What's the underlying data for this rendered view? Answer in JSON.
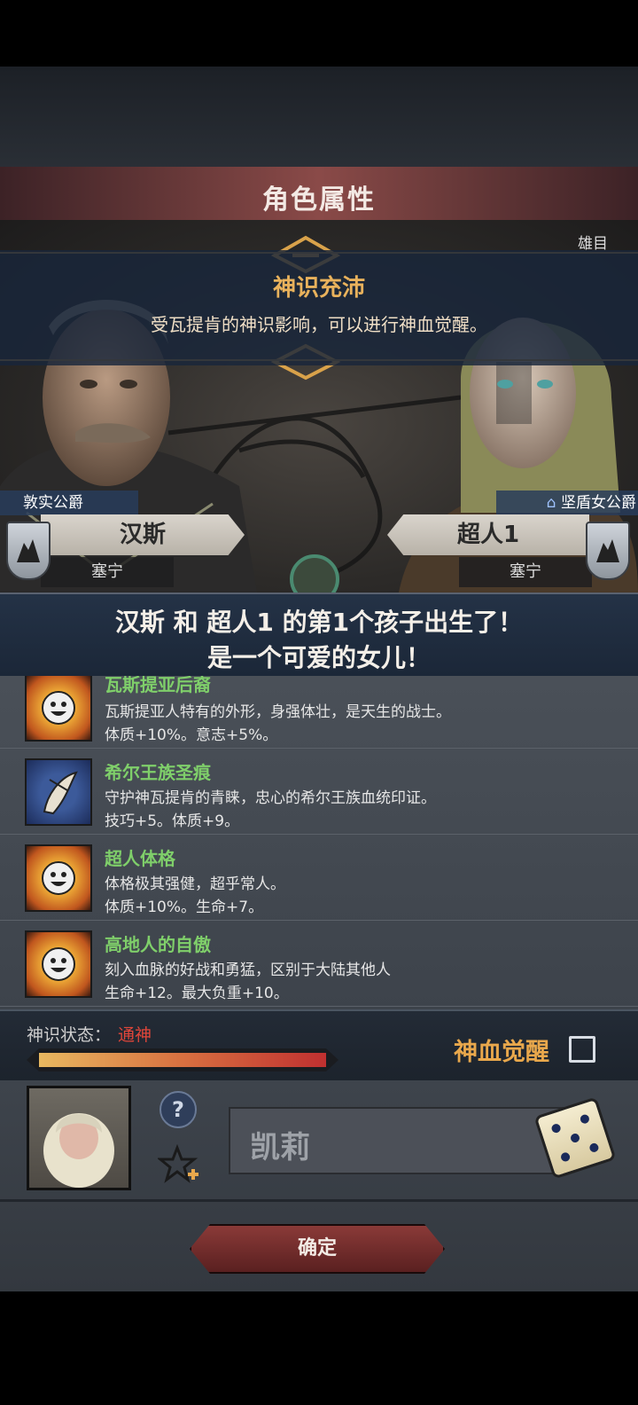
{
  "header": {
    "title": "角色属性"
  },
  "banner": {
    "title": "神识充沛",
    "text": "受瓦提肯的神识影响，可以进行神血觉醒。"
  },
  "scene": {
    "corner_label": "雄目"
  },
  "father": {
    "title": "敦实公爵",
    "name": "汉斯",
    "place": "塞宁"
  },
  "mother": {
    "title": "坚盾女公爵",
    "name": "超人1",
    "place": "塞宁"
  },
  "announcement": {
    "line1": "汉斯 和 超人1 的第1个孩子出生了！",
    "line2": "是一个可爱的女儿！"
  },
  "traits": [
    {
      "name": "瓦斯提亚后裔",
      "desc": "瓦斯提亚人特有的外形，身强体壮，是天生的战士。",
      "effect": "体质+10%。意志+5%。",
      "icon": "sun-face-icon"
    },
    {
      "name": "希尔王族圣痕",
      "desc": "守护神瓦提肯的青睐，忠心的希尔王族血统印证。",
      "effect": "技巧+5。体质+9。",
      "icon": "feather-crest-icon"
    },
    {
      "name": "超人体格",
      "desc": "体格极其强健，超乎常人。",
      "effect": "体质+10%。生命+7。",
      "icon": "sun-face-icon"
    },
    {
      "name": "高地人的自傲",
      "desc": "刻入血脉的好战和勇猛，区别于大陆其他人",
      "effect": "生命+12。最大负重+10。",
      "icon": "sun-face-icon"
    }
  ],
  "status": {
    "label": "神识状态：",
    "value": "通神",
    "progress": 1.0,
    "awaken_label": "神血觉醒",
    "awaken_checked": false
  },
  "child": {
    "name": "凯莉"
  },
  "confirm": {
    "label": "确定"
  },
  "colors": {
    "accent_gold": "#e9b25c",
    "trait_green": "#7fcf6a",
    "status_red": "#e0463a"
  }
}
